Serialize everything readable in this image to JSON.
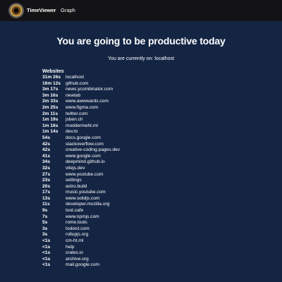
{
  "nav": {
    "items": [
      {
        "label": "TimeViewer"
      },
      {
        "label": "Graph"
      }
    ]
  },
  "main": {
    "headline": "You are going to be productive today",
    "current": "You are currently on: localhost",
    "sites_heading": "Websites",
    "sites": [
      {
        "time": "31m 26s",
        "site": "localhost"
      },
      {
        "time": "16m 12s",
        "site": "github.com"
      },
      {
        "time": "3m 17s",
        "site": "news.ycombinator.com"
      },
      {
        "time": "3m 16s",
        "site": "newtab"
      },
      {
        "time": "2m 33s",
        "site": "www.awwwards.com"
      },
      {
        "time": "2m 25s",
        "site": "www.figma.com"
      },
      {
        "time": "2m 11s",
        "site": "twitter.com"
      },
      {
        "time": "1m 19s",
        "site": "jsben.ch"
      },
      {
        "time": "1m 16s",
        "site": "moddermeht.ml"
      },
      {
        "time": "1m 14s",
        "site": "dev.to"
      },
      {
        "time": "54s",
        "site": "docs.google.com"
      },
      {
        "time": "42s",
        "site": "stackoverflow.com"
      },
      {
        "time": "42s",
        "site": "creative-coding.pages.dev"
      },
      {
        "time": "41s",
        "site": "www.google.com"
      },
      {
        "time": "34s",
        "site": "deepmind.github.io"
      },
      {
        "time": "32s",
        "site": "vitejs.dev"
      },
      {
        "time": "27s",
        "site": "www.youtube.com"
      },
      {
        "time": "23s",
        "site": "settings"
      },
      {
        "time": "20s",
        "site": "astro.build"
      },
      {
        "time": "17s",
        "site": "music.youtube.com"
      },
      {
        "time": "13s",
        "site": "www.solidjs.com"
      },
      {
        "time": "11s",
        "site": "developer.mozilla.org"
      },
      {
        "time": "9s",
        "site": "toot.cafe"
      },
      {
        "time": "7s",
        "site": "www.npmjs.com"
      },
      {
        "time": "5s",
        "site": "rome.tools"
      },
      {
        "time": "3s",
        "site": "todoist.com"
      },
      {
        "time": "3s",
        "site": "rollupjs.org"
      },
      {
        "time": "<1s",
        "site": "cm-ht.ml"
      },
      {
        "time": "<1s",
        "site": "help"
      },
      {
        "time": "<1s",
        "site": "crates.io"
      },
      {
        "time": "<1s",
        "site": "archive.org"
      },
      {
        "time": "<1s",
        "site": "mail.google.com"
      }
    ]
  }
}
